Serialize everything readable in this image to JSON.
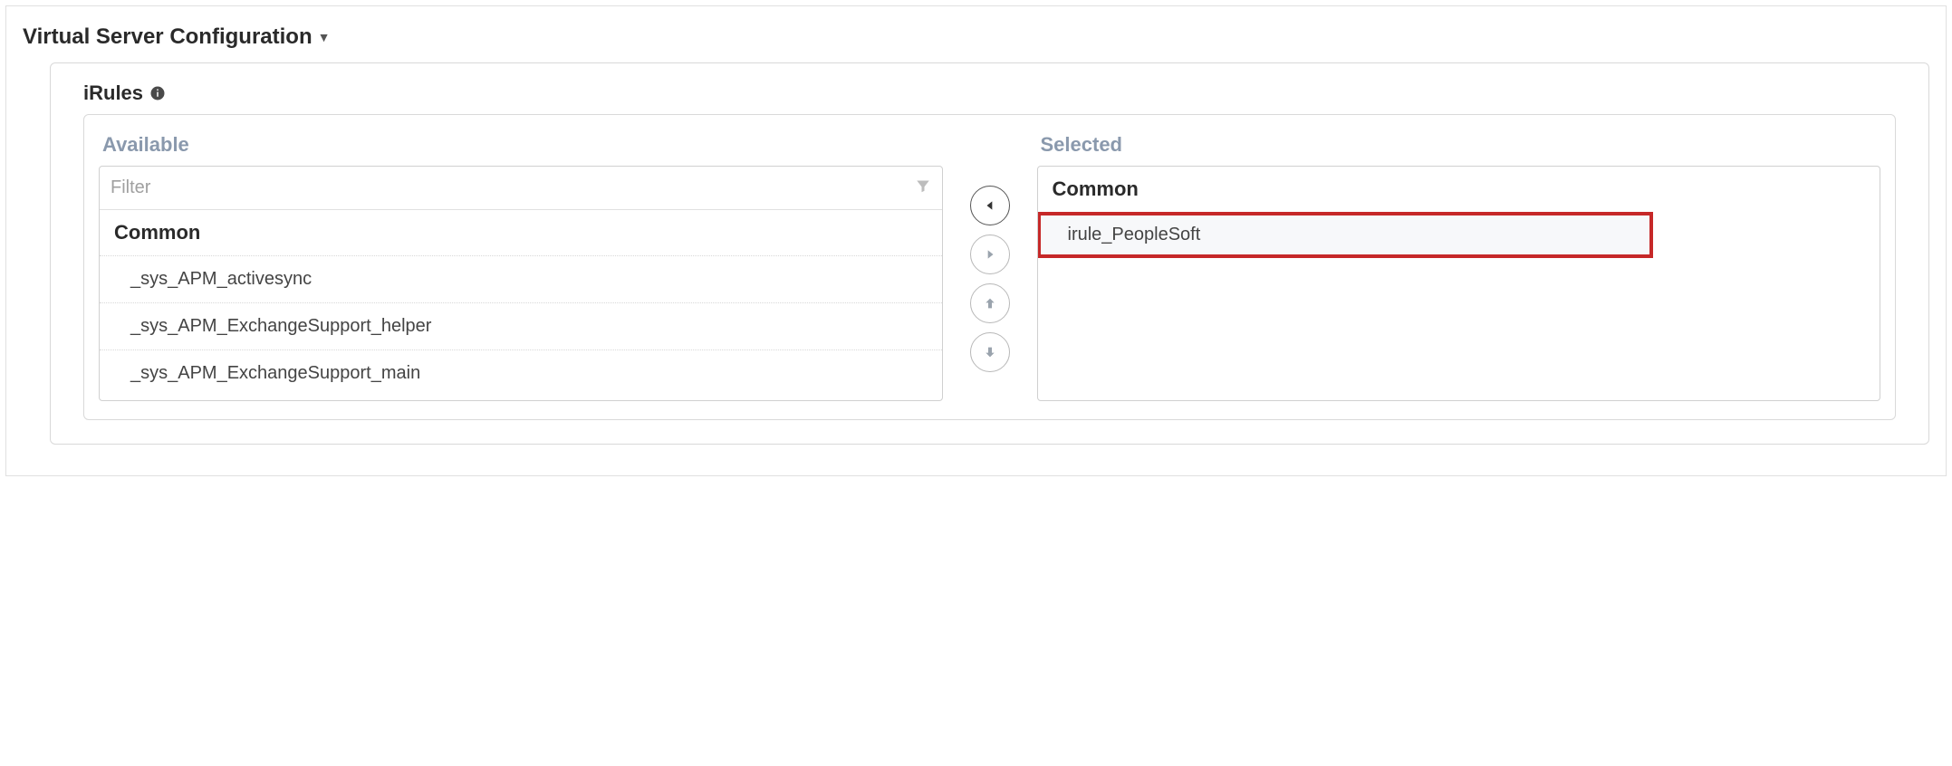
{
  "section": {
    "title": "Virtual Server Configuration"
  },
  "subsection": {
    "title": "iRules"
  },
  "available": {
    "label": "Available",
    "filter_placeholder": "Filter",
    "group_header": "Common",
    "items": [
      "_sys_APM_activesync",
      "_sys_APM_ExchangeSupport_helper",
      "_sys_APM_ExchangeSupport_main"
    ]
  },
  "selected": {
    "label": "Selected",
    "group_header": "Common",
    "items": [
      "irule_PeopleSoft"
    ]
  }
}
